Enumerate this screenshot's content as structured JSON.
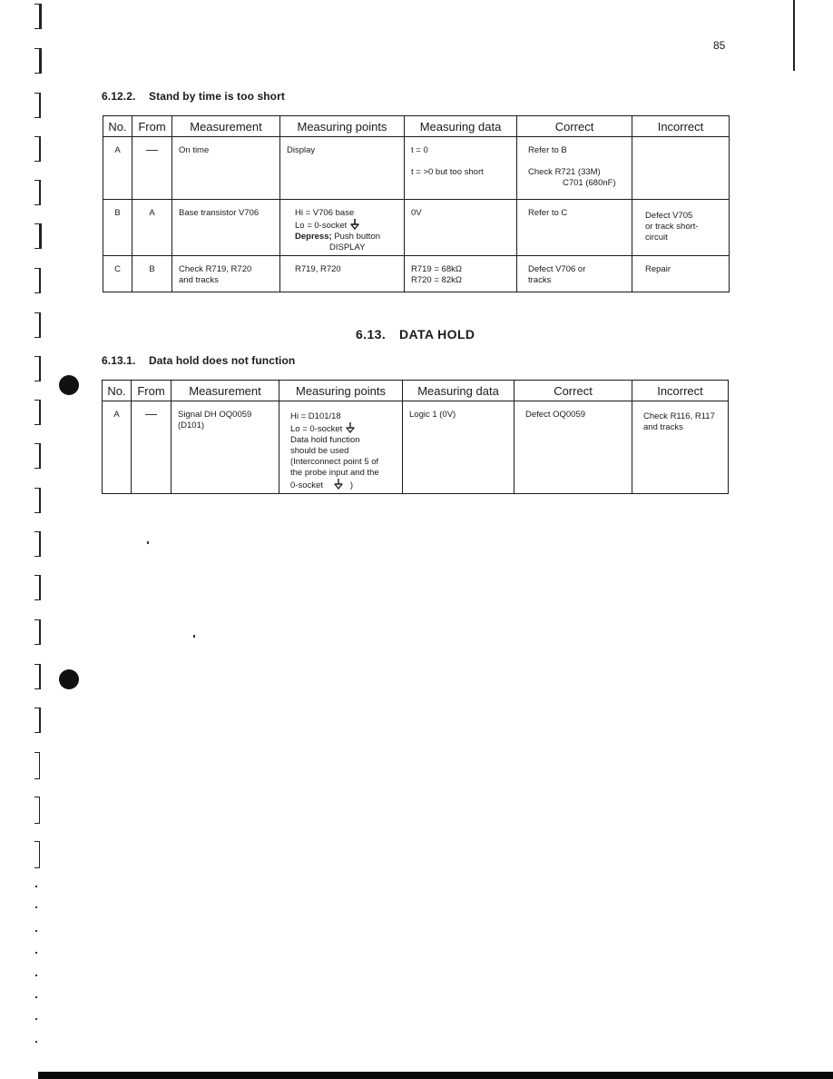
{
  "page": {
    "number": "85"
  },
  "section_6_12_2": {
    "number": "6.12.2.",
    "title": "Stand by time is too short",
    "headers": [
      "No.",
      "From",
      "Measurement",
      "Measuring points",
      "Measuring data",
      "Correct",
      "Incorrect"
    ],
    "rows": [
      {
        "no": "A",
        "from": "—",
        "measurement": "On time",
        "points": [
          "Display"
        ],
        "data": [
          "t = 0",
          "t = >0 but too short"
        ],
        "correct": [
          "Refer to B",
          "Check R721 (33M)",
          "C701 (680nF)"
        ],
        "incorrect": []
      },
      {
        "no": "B",
        "from": "A",
        "measurement": "Base transistor V706",
        "points": [
          "Hi = V706 base",
          "Lo = 0-socket",
          "Depress;",
          "Push button",
          "DISPLAY"
        ],
        "data": [
          "0V"
        ],
        "correct": [
          "Refer to C"
        ],
        "incorrect": [
          "Defect V705",
          "or track short-",
          "circuit"
        ]
      },
      {
        "no": "C",
        "from": "B",
        "measurement": [
          "Check R719, R720",
          "and tracks"
        ],
        "points": [
          "R719, R720"
        ],
        "data": [
          "R719 = 68kΩ",
          "R720 = 82kΩ"
        ],
        "correct": [
          "Defect V706 or",
          "tracks"
        ],
        "incorrect": [
          "Repair"
        ]
      }
    ]
  },
  "section_6_13": {
    "number": "6.13.",
    "title": "DATA HOLD"
  },
  "section_6_13_1": {
    "number": "6.13.1.",
    "title": "Data hold does not function",
    "headers": [
      "No.",
      "From",
      "Measurement",
      "Measuring points",
      "Measuring data",
      "Correct",
      "Incorrect"
    ],
    "rows": [
      {
        "no": "A",
        "from": "—",
        "measurement": [
          "Signal DH OQ0059",
          "(D101)"
        ],
        "points": [
          "Hi = D101/18",
          "Lo = 0-socket",
          "Data hold function",
          "should be used",
          "(Interconnect point 5 of",
          "the probe input and the",
          "0-socket",
          ")"
        ],
        "data": [
          "Logic 1 (0V)"
        ],
        "correct": [
          "Defect OQ0059"
        ],
        "incorrect": [
          "Check R116, R117",
          "and tracks"
        ]
      }
    ]
  },
  "icons": {
    "ground": "ground-symbol-icon",
    "binder": "binder-margin-mark",
    "punch_hole": "punch-hole"
  }
}
